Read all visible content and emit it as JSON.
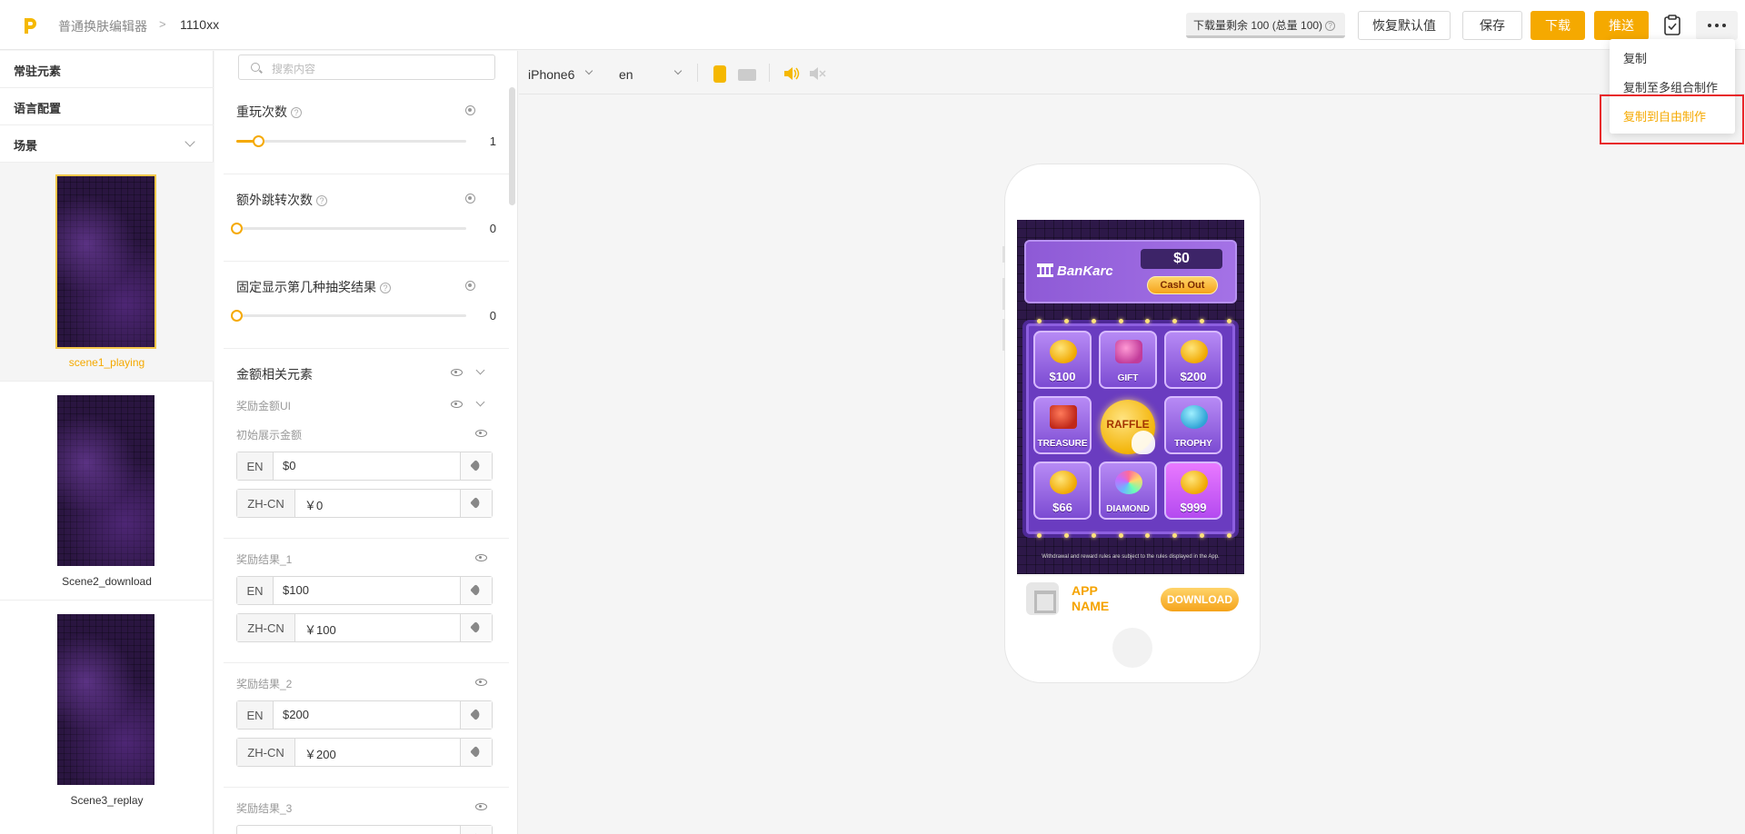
{
  "header": {
    "breadcrumb_root": "普通换肤编辑器",
    "breadcrumb_sep": ">",
    "breadcrumb_current": "1110xx",
    "quota_text": "下载量剩余 100 (总量 100)",
    "restore_label": "恢复默认值",
    "save_label": "保存",
    "download_label": "下载",
    "push_label": "推送",
    "accent_color": "#f5a900"
  },
  "dropdown": {
    "items": [
      "复制",
      "复制至多组合制作",
      "复制到自由制作"
    ],
    "highlight_color": "#e8262a"
  },
  "sidebar": {
    "items": [
      "常驻元素",
      "语言配置",
      "场景"
    ],
    "scenes": [
      "scene1_playing",
      "Scene2_download",
      "Scene3_replay"
    ]
  },
  "props": {
    "search_placeholder": "搜索内容",
    "sliders": [
      {
        "label": "重玩次数",
        "value": "1",
        "fraction": 0.08
      },
      {
        "label": "额外跳转次数",
        "value": "0",
        "fraction": 0
      },
      {
        "label": "固定显示第几种抽奖结果",
        "value": "0",
        "fraction": 0
      }
    ],
    "amount_section": "金额相关元素",
    "reward_ui": "奖励金额UI",
    "initial_amount": "初始展示金额",
    "initial_fields": {
      "en_prefix": "EN",
      "en_value": "$0",
      "zh_prefix": "ZH-CN",
      "zh_value": "￥0"
    },
    "results": [
      {
        "title": "奖励结果_1",
        "en_prefix": "EN",
        "en_value": "$100",
        "zh_prefix": "ZH-CN",
        "zh_value": "￥100"
      },
      {
        "title": "奖励结果_2",
        "en_prefix": "EN",
        "en_value": "$200",
        "zh_prefix": "ZH-CN",
        "zh_value": "￥200"
      },
      {
        "title": "奖励结果_3"
      }
    ]
  },
  "canvas": {
    "device": "iPhone6",
    "language": "en",
    "game": {
      "bank_name": "BanKarc",
      "balance": "$0",
      "cashout_label": "Cash Out",
      "tiles": [
        "$100",
        "GIFT",
        "$200",
        "TREASURE",
        "RAFFLE",
        "TROPHY",
        "$66",
        "DIAMOND",
        "$999"
      ],
      "disclaimer": "Withdrawal and reward rules are subject to the rules displayed in the App.",
      "app_name": "APP NAME",
      "download_label": "DOWNLOAD"
    }
  }
}
